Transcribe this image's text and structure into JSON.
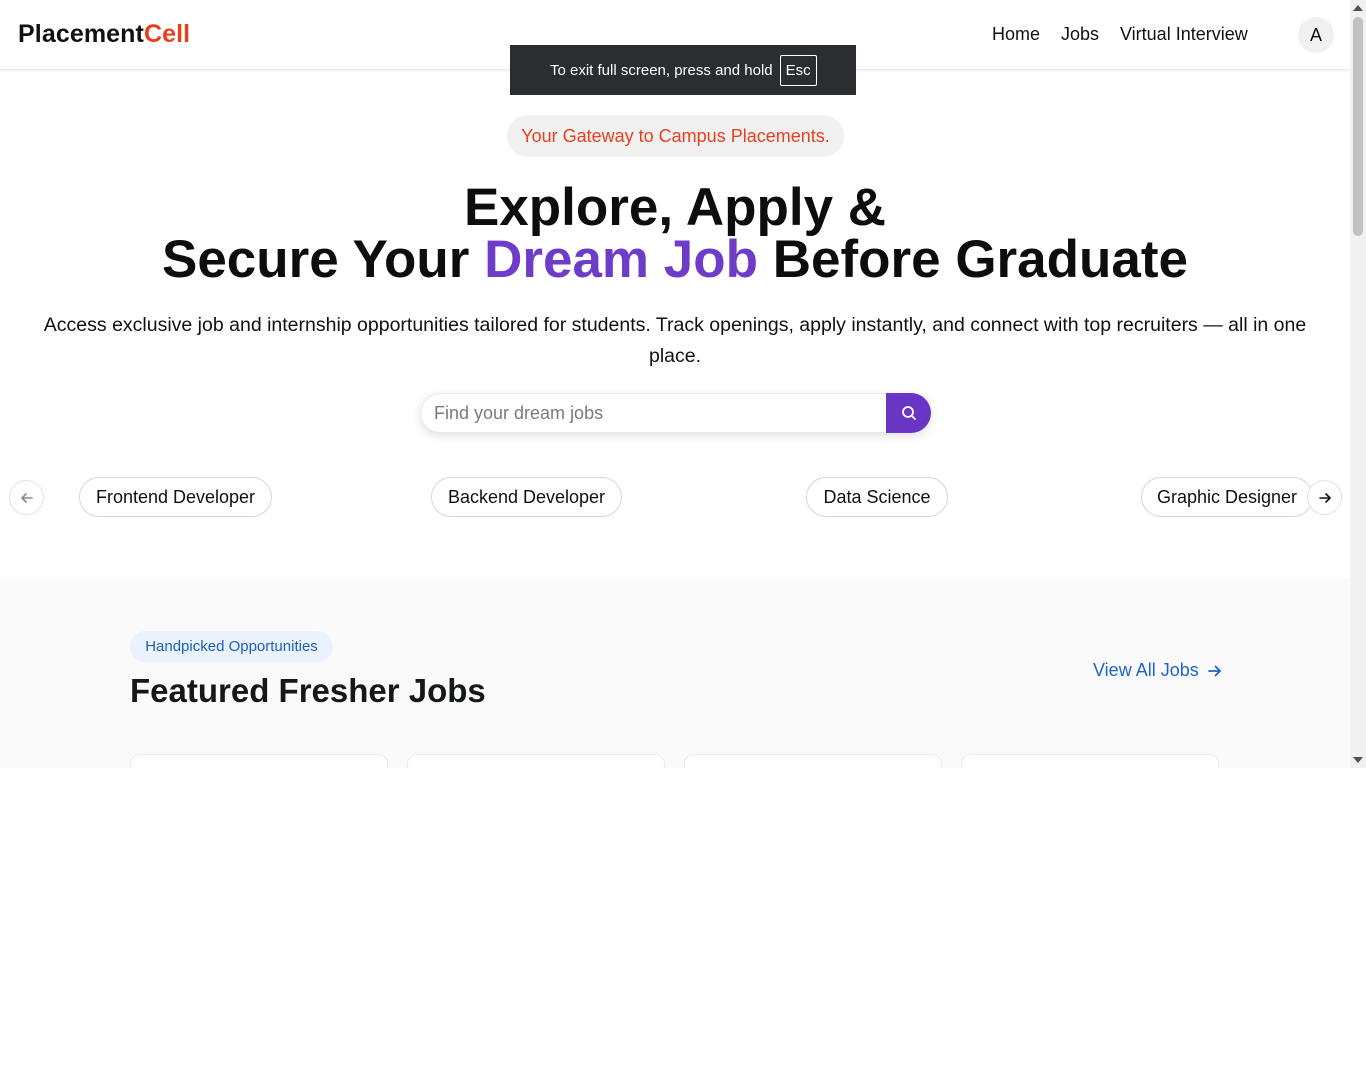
{
  "header": {
    "logo_main": "Placement",
    "logo_accent": "Cell",
    "nav": [
      "Home",
      "Jobs",
      "Virtual Interview"
    ],
    "avatar_initial": "A"
  },
  "fullscreen_notice": {
    "text": "To exit full screen, press and hold",
    "key": "Esc"
  },
  "hero": {
    "tagline": "Your Gateway to Campus Placements.",
    "title_line1": "Explore, Apply &",
    "title_line2_pre": "Secure Your ",
    "title_line2_highlight": "Dream Job",
    "title_line2_post": " Before Graduate",
    "description": "Access exclusive job and internship opportunities tailored for students. Track openings, apply instantly, and connect with top recruiters — all in one place.",
    "search_placeholder": "Find your dream jobs",
    "search_icon": "search-icon"
  },
  "categories": {
    "items": [
      "Frontend Developer",
      "Backend Developer",
      "Data Science",
      "Graphic Designer"
    ],
    "prev_icon": "arrow-left-icon",
    "next_icon": "arrow-right-icon"
  },
  "featured": {
    "badge": "Handpicked Opportunities",
    "title": "Featured Fresher Jobs",
    "view_all": "View All Jobs",
    "view_all_icon": "arrow-right-icon"
  },
  "colors": {
    "accent_orange": "#e8401c",
    "brand_purple": "#6f3bc9",
    "link_blue": "#1f62c9"
  }
}
